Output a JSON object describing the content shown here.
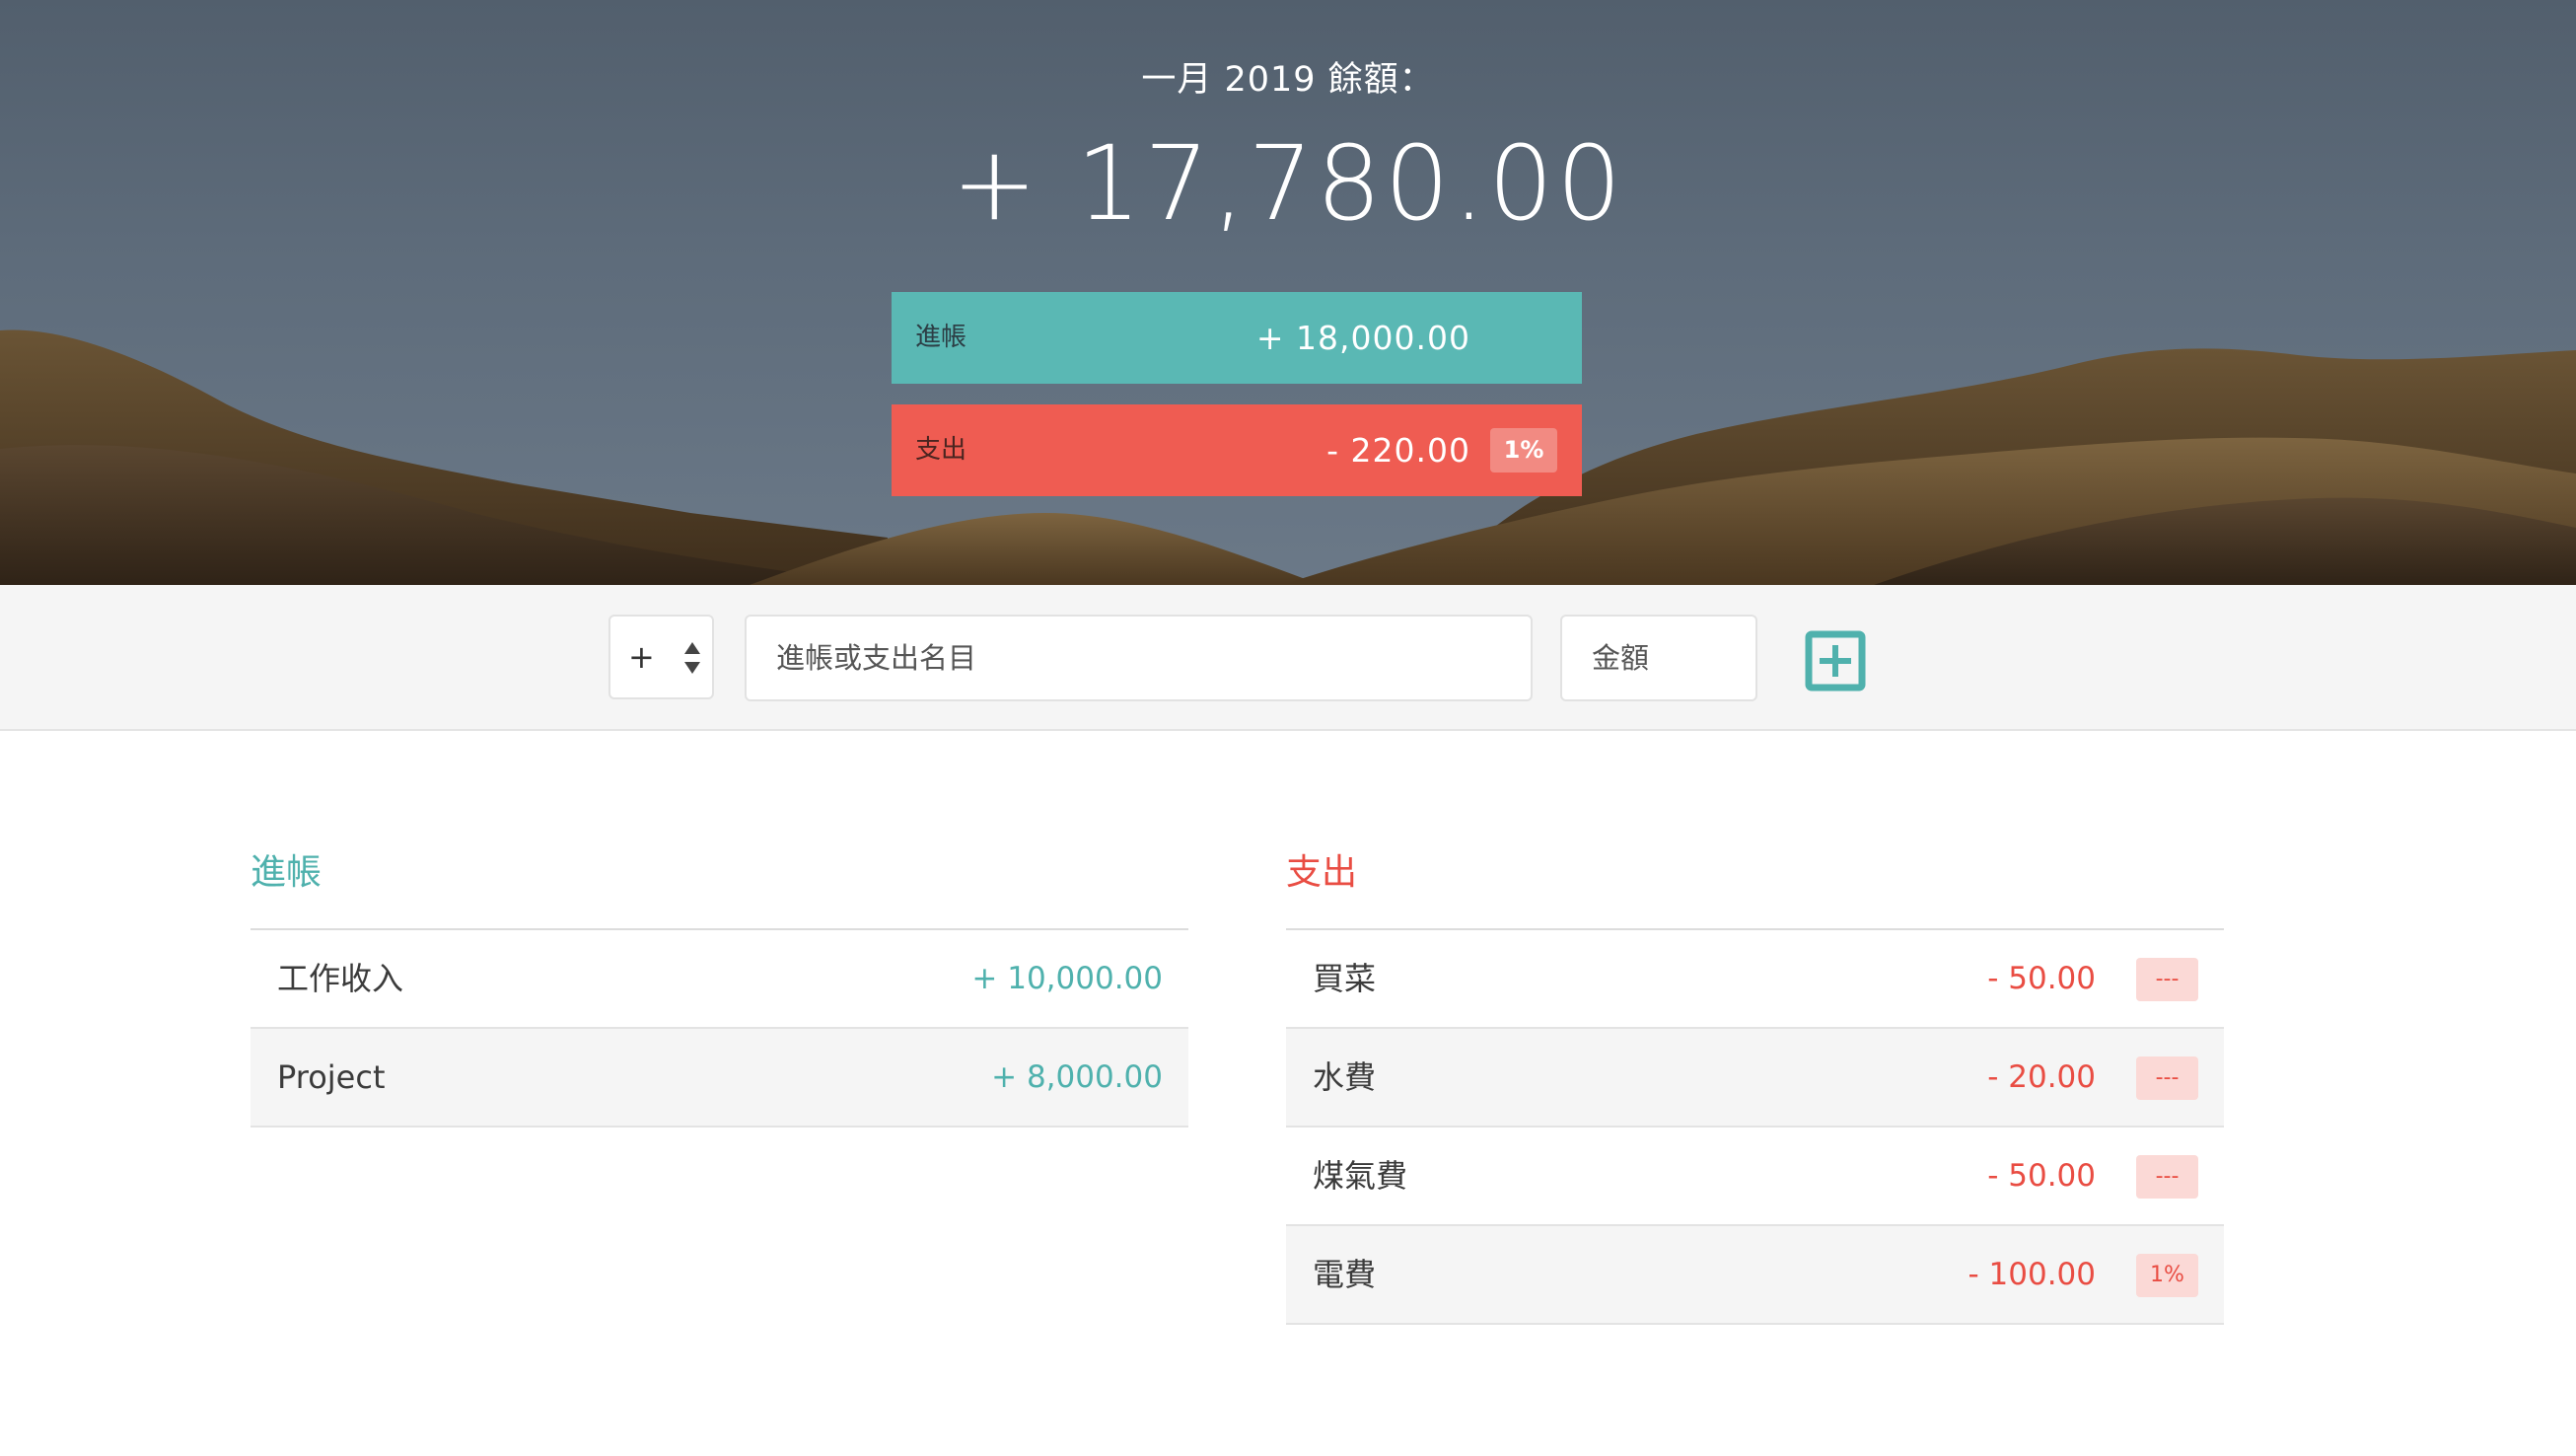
{
  "hero": {
    "title": "一月 2019 餘額：",
    "balance": "+ 17,780.00",
    "income_bar": {
      "label": "進帳",
      "value": "+ 18,000.00"
    },
    "expense_bar": {
      "label": "支出",
      "value": "- 220.00",
      "percent": "1%"
    }
  },
  "add_form": {
    "type_value": "+",
    "name_placeholder": "進帳或支出名目",
    "amount_placeholder": "金額",
    "add_icon": "plus-square-icon"
  },
  "income": {
    "title": "進帳",
    "items": [
      {
        "name": "工作收入",
        "amount": "+ 10,000.00"
      },
      {
        "name": "Project",
        "amount": "+ 8,000.00"
      }
    ]
  },
  "expense": {
    "title": "支出",
    "items": [
      {
        "name": "買菜",
        "amount": "- 50.00",
        "percent": "---"
      },
      {
        "name": "水費",
        "amount": "- 20.00",
        "percent": "---"
      },
      {
        "name": "煤氣費",
        "amount": "- 50.00",
        "percent": "---"
      },
      {
        "name": "電費",
        "amount": "- 100.00",
        "percent": "1%"
      }
    ]
  },
  "colors": {
    "income": "#5ab8b4",
    "expense": "#ef5c52",
    "income_text": "#4fb1ad",
    "expense_text": "#e94d43"
  }
}
